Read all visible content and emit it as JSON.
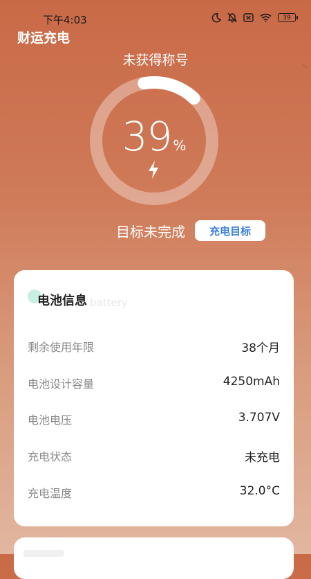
{
  "status_bar": {
    "time": "下午4:03",
    "battery_level": "39",
    "icons": [
      "moon-icon",
      "bell-muted-icon",
      "sim-card-x-icon",
      "wifi-icon",
      "battery-icon"
    ]
  },
  "app": {
    "title": "财运充电"
  },
  "gauge": {
    "honor_title": "未获得称号",
    "percent_value": "39",
    "percent_sign": "%",
    "charge_fraction": 0.39,
    "icon": "lightning-bolt-icon"
  },
  "goal": {
    "status": "目标未完成",
    "button_label": "充电目标"
  },
  "battery_card": {
    "title": "电池信息",
    "watermark": "battery",
    "rows": [
      {
        "label": "剩余使用年限",
        "value": "38个月"
      },
      {
        "label": "电池设计容量",
        "value": "4250mAh"
      },
      {
        "label": "电池电压",
        "value": "3.707V"
      },
      {
        "label": "充电状态",
        "value": "未充电"
      },
      {
        "label": "充电温度",
        "value": "32.0°C"
      }
    ]
  },
  "colors": {
    "accent_blue": "#3b7fd6",
    "background_top": "#c96a47",
    "background_bottom": "#e2b69f",
    "card": "#ffffff",
    "dot": "#c8efe0"
  }
}
